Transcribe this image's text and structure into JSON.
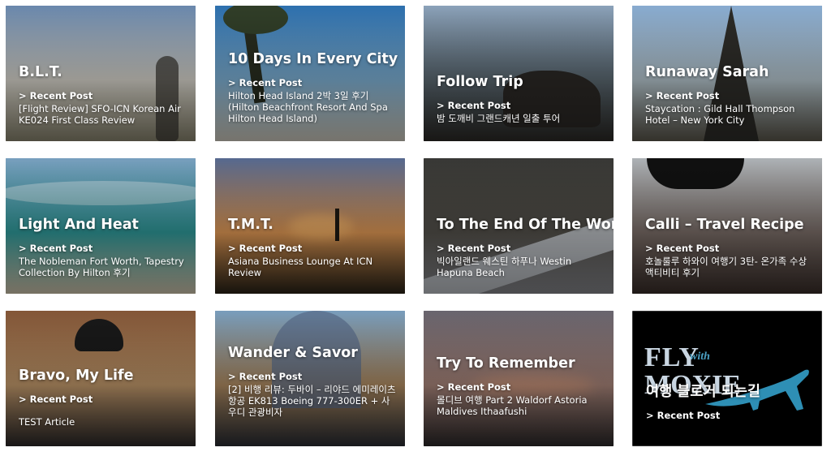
{
  "recent_label": "> Recent Post",
  "cards": [
    {
      "title": "B.L.T.",
      "post": "[Flight Review] SFO-ICN Korean Air KE024 First Class Review",
      "colors": [
        "#6f8fb6",
        "#d9d6cd",
        "#8f8a73"
      ]
    },
    {
      "title": "10 Days In Every City",
      "post": "Hilton Head Island 2박 3일 후기 (Hilton Beachfront Resort And Spa Hilton Head Island)",
      "colors": [
        "#2f76b8",
        "#7fb2d6",
        "#d8d3c6"
      ]
    },
    {
      "title": "Follow Trip",
      "post": "밤 도깨비 그랜드캐년 일출 투어",
      "colors": [
        "#93abc4",
        "#5c6a73",
        "#2c2a26"
      ]
    },
    {
      "title": "Runaway Sarah",
      "post": "Staycation : Gild Hall Thompson Hotel – New York City",
      "colors": [
        "#8fb4db",
        "#b7c7cf",
        "#5e5a4e"
      ]
    },
    {
      "title": "Light And Heat",
      "post": "The Nobleman Fort Worth, Tapestry Collection By Hilton 후기",
      "colors": [
        "#7fa8c9",
        "#2f9a9a",
        "#d9cdb4"
      ]
    },
    {
      "title": "T.M.T.",
      "post": "Asiana Business Lounge At ICN Review",
      "colors": [
        "#5a6e97",
        "#e39a55",
        "#2b2418"
      ]
    },
    {
      "title": "To The End Of The World",
      "post": "빅아일랜드 웨스틴 하푸나 Westin Hapuna Beach",
      "colors": [
        "#3b3b38",
        "#54514b",
        "#8a8b90"
      ]
    },
    {
      "title": "Calli – Travel Recipe",
      "post": "호놀룰루 하와이 여행기 3탄- 온가족 수상 액티비티 후기",
      "colors": [
        "#b7bcc0",
        "#7c6f69",
        "#3b2f2b"
      ]
    },
    {
      "title": "Bravo, My Life",
      "post": "TEST Article",
      "colors": [
        "#8a5a3a",
        "#c39a6c",
        "#2d2a2a"
      ]
    },
    {
      "title": "Wander & Savor",
      "post": "[2] 비행 리뷰: 두바이 – 리야드 에미레이츠 항공 EK813 Boeing 777-300ER + 사우디 관광비자",
      "colors": [
        "#7fa6c7",
        "#b08c62",
        "#2b2e35"
      ]
    },
    {
      "title": "Try To Remember",
      "post": "몰디브 여행 Part 2 Waldorf Astoria Maldives Ithaafushi",
      "colors": [
        "#6e6a74",
        "#a9857a",
        "#2e2a2b"
      ]
    },
    {
      "title": "여행 블로거 되는길",
      "post": "",
      "colors": [
        "#000000",
        "#000000",
        "#000000"
      ],
      "logo": {
        "line1": "FLY",
        "with": "with",
        "line2": "MOXIE",
        "accent": "#2e8fb5"
      }
    }
  ]
}
